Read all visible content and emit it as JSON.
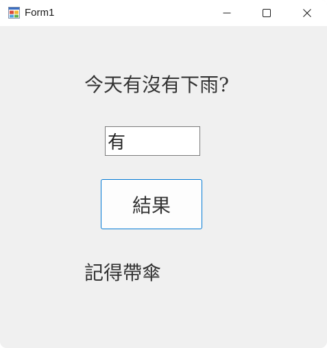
{
  "window": {
    "title": "Form1",
    "icon": "winforms-app-icon",
    "controls": {
      "minimize_icon": "minimize-icon",
      "maximize_icon": "maximize-icon",
      "close_icon": "close-icon"
    }
  },
  "form": {
    "question_label": "今天有沒有下雨?",
    "answer_input_value": "有",
    "result_button_label": "結果",
    "result_label": "記得帶傘"
  },
  "colors": {
    "form_background": "#f0f0f0",
    "titlebar_background": "#ffffff",
    "button_border_accent": "#0078d4",
    "text": "#333333"
  }
}
